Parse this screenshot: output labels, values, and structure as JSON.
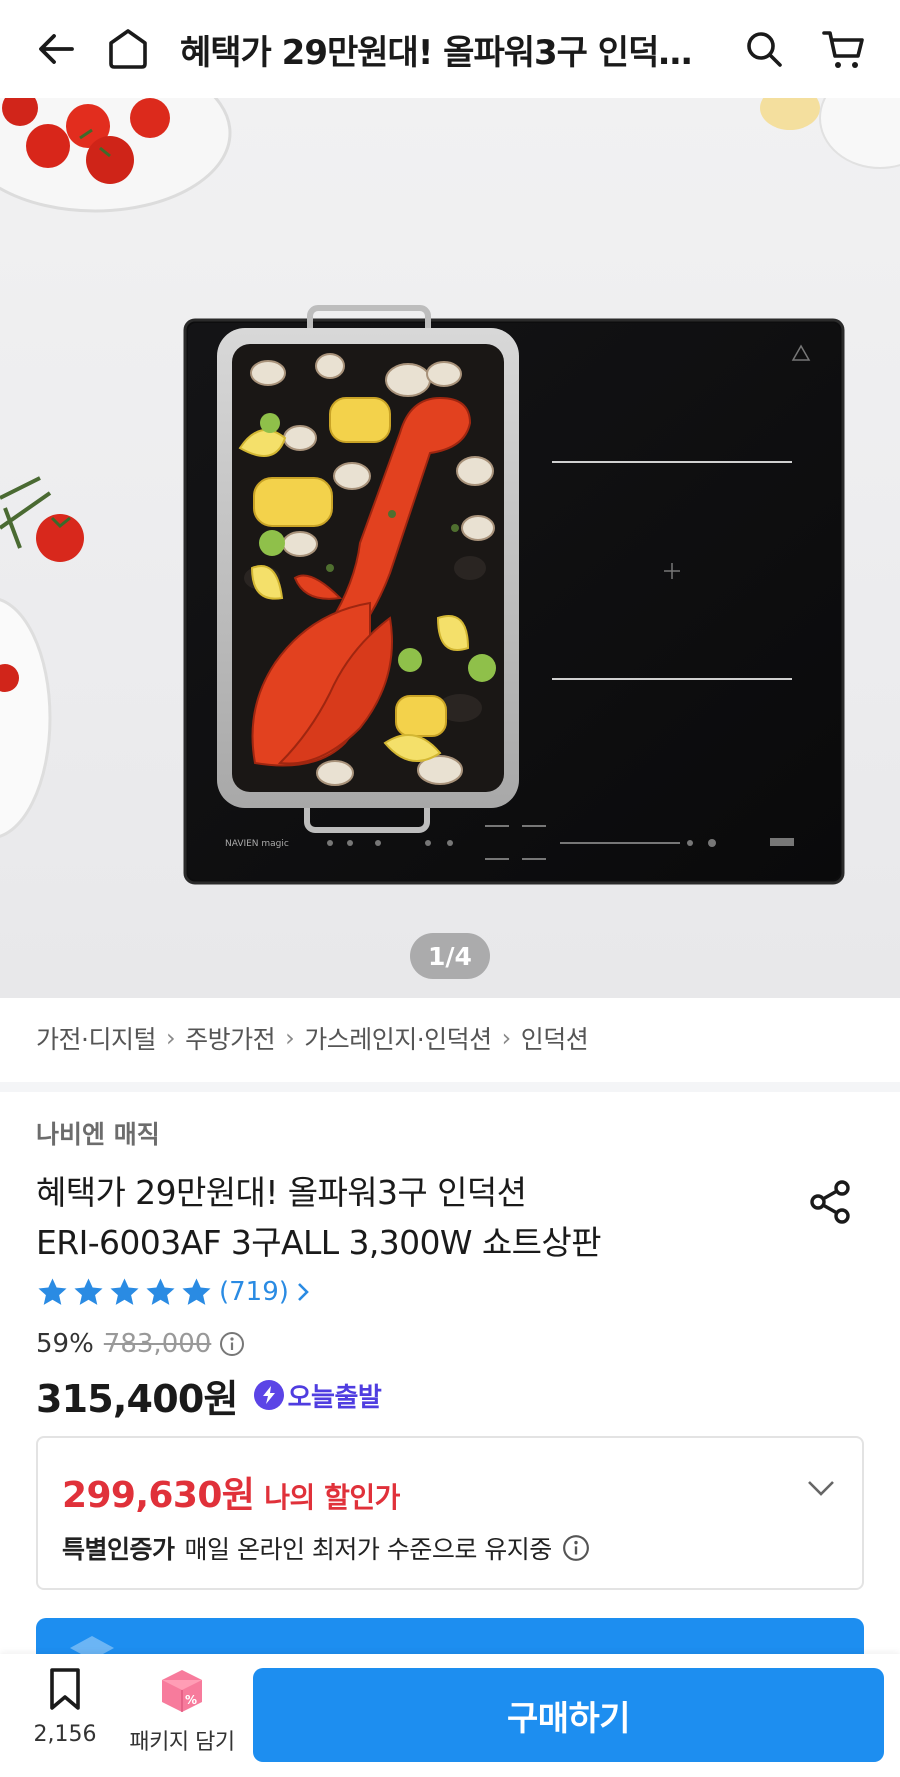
{
  "header": {
    "title": "혜택가 29만원대! 올파워3구 인덕션 ERI-6003AF 3구ALL 3,300W 쇼트상판"
  },
  "gallery": {
    "pager": "1/4",
    "cooktop_brand_text": "NAVIEN magic"
  },
  "breadcrumb": [
    "가전·디지털",
    "주방가전",
    "가스레인지·인덕션",
    "인덕션"
  ],
  "product": {
    "brand": "나비엔 매직",
    "name_line1": "혜택가 29만원대! 올파워3구 인덕션",
    "name_line2": "ERI-6003AF 3구ALL 3,300W  쇼트상판",
    "rating_stars": 5,
    "rating_count": "(719)",
    "discount_rate": "59%",
    "original_price": "783,000",
    "price": "315,400원",
    "delivery_badge": "오늘출발"
  },
  "my_discount": {
    "price": "299,630원",
    "label": "나의 할인가",
    "special_label": "특별인증가",
    "special_text": "매일 온라인 최저가 수준으로 유지중"
  },
  "bottom_bar": {
    "bookmark_count": "2,156",
    "package_label": "패키지 담기",
    "buy_label": "구매하기"
  },
  "colors": {
    "primary": "#1d8ef0",
    "discount_red": "#e0313a",
    "star_blue": "#2a8be3",
    "today_purple": "#5b44e6"
  }
}
